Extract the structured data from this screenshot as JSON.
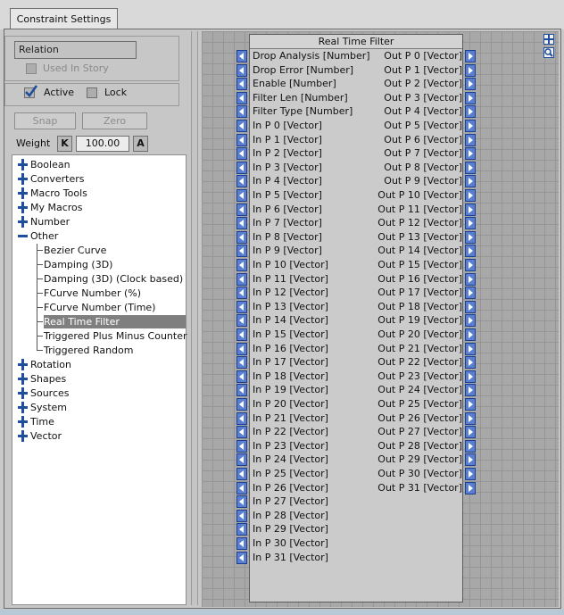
{
  "tab": {
    "label": "Constraint Settings"
  },
  "relation": {
    "field_value": "Relation",
    "used_in_story_label": "Used In Story",
    "active_label": "Active",
    "active_checked": true,
    "lock_label": "Lock",
    "lock_checked": false
  },
  "buttons": {
    "snap": "Snap",
    "zero": "Zero"
  },
  "weight": {
    "label": "Weight",
    "key_btn": "K",
    "value": "100.00",
    "anim_btn": "A"
  },
  "tree": {
    "categories_top": [
      "Boolean",
      "Converters",
      "Macro Tools",
      "My Macros",
      "Number"
    ],
    "expanded": "Other",
    "children": [
      "Bezier Curve",
      "Damping (3D)",
      "Damping (3D) (Clock based)",
      "FCurve Number (%)",
      "FCurve Number (Time)",
      "Real Time Filter",
      "Triggered Plus Minus Counter",
      "Triggered Random"
    ],
    "selected": "Real Time Filter",
    "categories_bottom": [
      "Rotation",
      "Shapes",
      "Sources",
      "System",
      "Time",
      "Vector"
    ]
  },
  "graph_icons": [
    "move-icon",
    "zoom-icon"
  ],
  "node": {
    "title": "Real Time Filter",
    "inputs": [
      "Drop Analysis [Number]",
      "Drop Error [Number]",
      "Enable [Number]",
      "Filter Len [Number]",
      "Filter Type [Number]",
      "In P  0 [Vector]",
      "In P  1 [Vector]",
      "In P  2 [Vector]",
      "In P  3 [Vector]",
      "In P  4 [Vector]",
      "In P  5 [Vector]",
      "In P  6 [Vector]",
      "In P  7 [Vector]",
      "In P  8 [Vector]",
      "In P  9 [Vector]",
      "In P 10 [Vector]",
      "In P 11 [Vector]",
      "In P 12 [Vector]",
      "In P 13 [Vector]",
      "In P 14 [Vector]",
      "In P 15 [Vector]",
      "In P 16 [Vector]",
      "In P 17 [Vector]",
      "In P 18 [Vector]",
      "In P 19 [Vector]",
      "In P 20 [Vector]",
      "In P 21 [Vector]",
      "In P 22 [Vector]",
      "In P 23 [Vector]",
      "In P 24 [Vector]",
      "In P 25 [Vector]",
      "In P 26 [Vector]",
      "In P 27 [Vector]",
      "In P 28 [Vector]",
      "In P 29 [Vector]",
      "In P 30 [Vector]",
      "In P 31 [Vector]"
    ],
    "outputs": [
      "Out P  0 [Vector]",
      "Out P  1 [Vector]",
      "Out P  2 [Vector]",
      "Out P  3 [Vector]",
      "Out P  4 [Vector]",
      "Out P  5 [Vector]",
      "Out P  6 [Vector]",
      "Out P  7 [Vector]",
      "Out P  8 [Vector]",
      "Out P  9 [Vector]",
      "Out P 10 [Vector]",
      "Out P 11 [Vector]",
      "Out P 12 [Vector]",
      "Out P 13 [Vector]",
      "Out P 14 [Vector]",
      "Out P 15 [Vector]",
      "Out P 16 [Vector]",
      "Out P 17 [Vector]",
      "Out P 18 [Vector]",
      "Out P 19 [Vector]",
      "Out P 20 [Vector]",
      "Out P 21 [Vector]",
      "Out P 22 [Vector]",
      "Out P 23 [Vector]",
      "Out P 24 [Vector]",
      "Out P 25 [Vector]",
      "Out P 26 [Vector]",
      "Out P 27 [Vector]",
      "Out P 28 [Vector]",
      "Out P 29 [Vector]",
      "Out P 30 [Vector]",
      "Out P 31 [Vector]"
    ]
  },
  "colors": {
    "accent": "#1f4e9e",
    "selection": "#7f7f7f",
    "pin": "#5b7fd0"
  }
}
